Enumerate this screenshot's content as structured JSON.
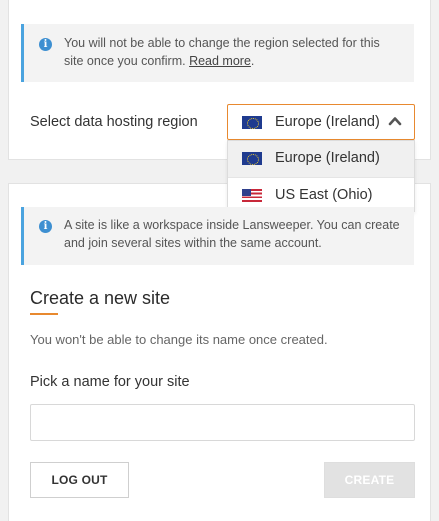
{
  "region_notice": {
    "text": "You will not be able to change the region selected for this site once you confirm.",
    "link": "Read more"
  },
  "region_select": {
    "label": "Select data hosting region",
    "selected": "Europe (Ireland)",
    "selected_flag": "eu-flag-icon",
    "options": [
      {
        "label": "Europe (Ireland)",
        "flag": "eu-flag-icon"
      },
      {
        "label": "US East (Ohio)",
        "flag": "us-flag-icon"
      }
    ]
  },
  "site_notice": {
    "text": "A site is like a workspace inside Lansweeper. You can create and join several sites within the same account."
  },
  "create_site": {
    "heading": "Create a new site",
    "subtext": "You won't be able to change its name once created.",
    "name_label": "Pick a name for your site",
    "name_value": "",
    "name_placeholder": ""
  },
  "buttons": {
    "logout": "LOG OUT",
    "create": "CREATE"
  },
  "colors": {
    "accent": "#e8892f",
    "info": "#3d8fd1",
    "notice_border": "#4aa3df"
  }
}
